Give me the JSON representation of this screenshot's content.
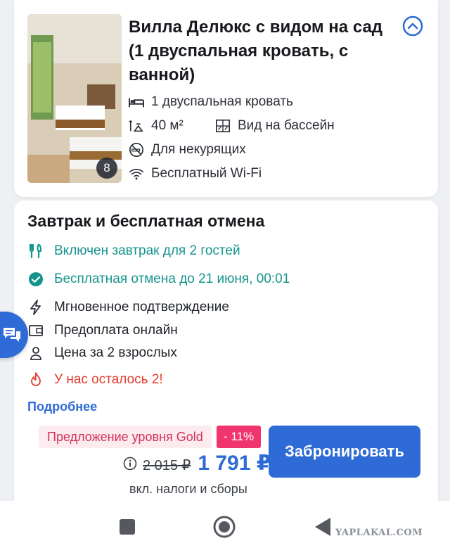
{
  "room": {
    "title": "Вилла Делюкс с видом на сад (1 двуспальная кровать, с ванной)",
    "photo_count": "8",
    "features": {
      "bed": "1 двуспальная кровать",
      "area": "40 м²",
      "view": "Вид на бассейн",
      "smoking": "Для некурящих",
      "wifi": "Бесплатный Wi-Fi"
    },
    "icons": {
      "bed": "bed-icon",
      "area": "area-icon",
      "view": "window-icon",
      "smoking": "no-smoking-icon",
      "wifi": "wifi-icon",
      "collapse": "chevron-up-icon"
    }
  },
  "offer": {
    "title": "Завтрак и бесплатная отмена",
    "perks": {
      "breakfast": "Включен завтрак для 2 гостей",
      "cancellation": "Бесплатная отмена до 21 июня, 00:01",
      "confirmation": "Мгновенное подтверждение",
      "prepay": "Предоплата онлайн",
      "price_for": "Цена за 2 взрослых",
      "rooms_left": "У нас осталось 2!"
    },
    "more_link": "Подробнее",
    "gold_badge": "Предложение уровня Gold",
    "discount": "- 11%",
    "old_price": "2 015 ₽",
    "price": "1 791 ₽",
    "tax_note": "вкл. налоги и сборы",
    "book_label": "Забронировать"
  },
  "colors": {
    "accent": "#2f6bd6",
    "green": "#14948d",
    "red": "#e23c2c",
    "pink": "#f0356e"
  },
  "watermark": "YAPLAKAL.COM"
}
